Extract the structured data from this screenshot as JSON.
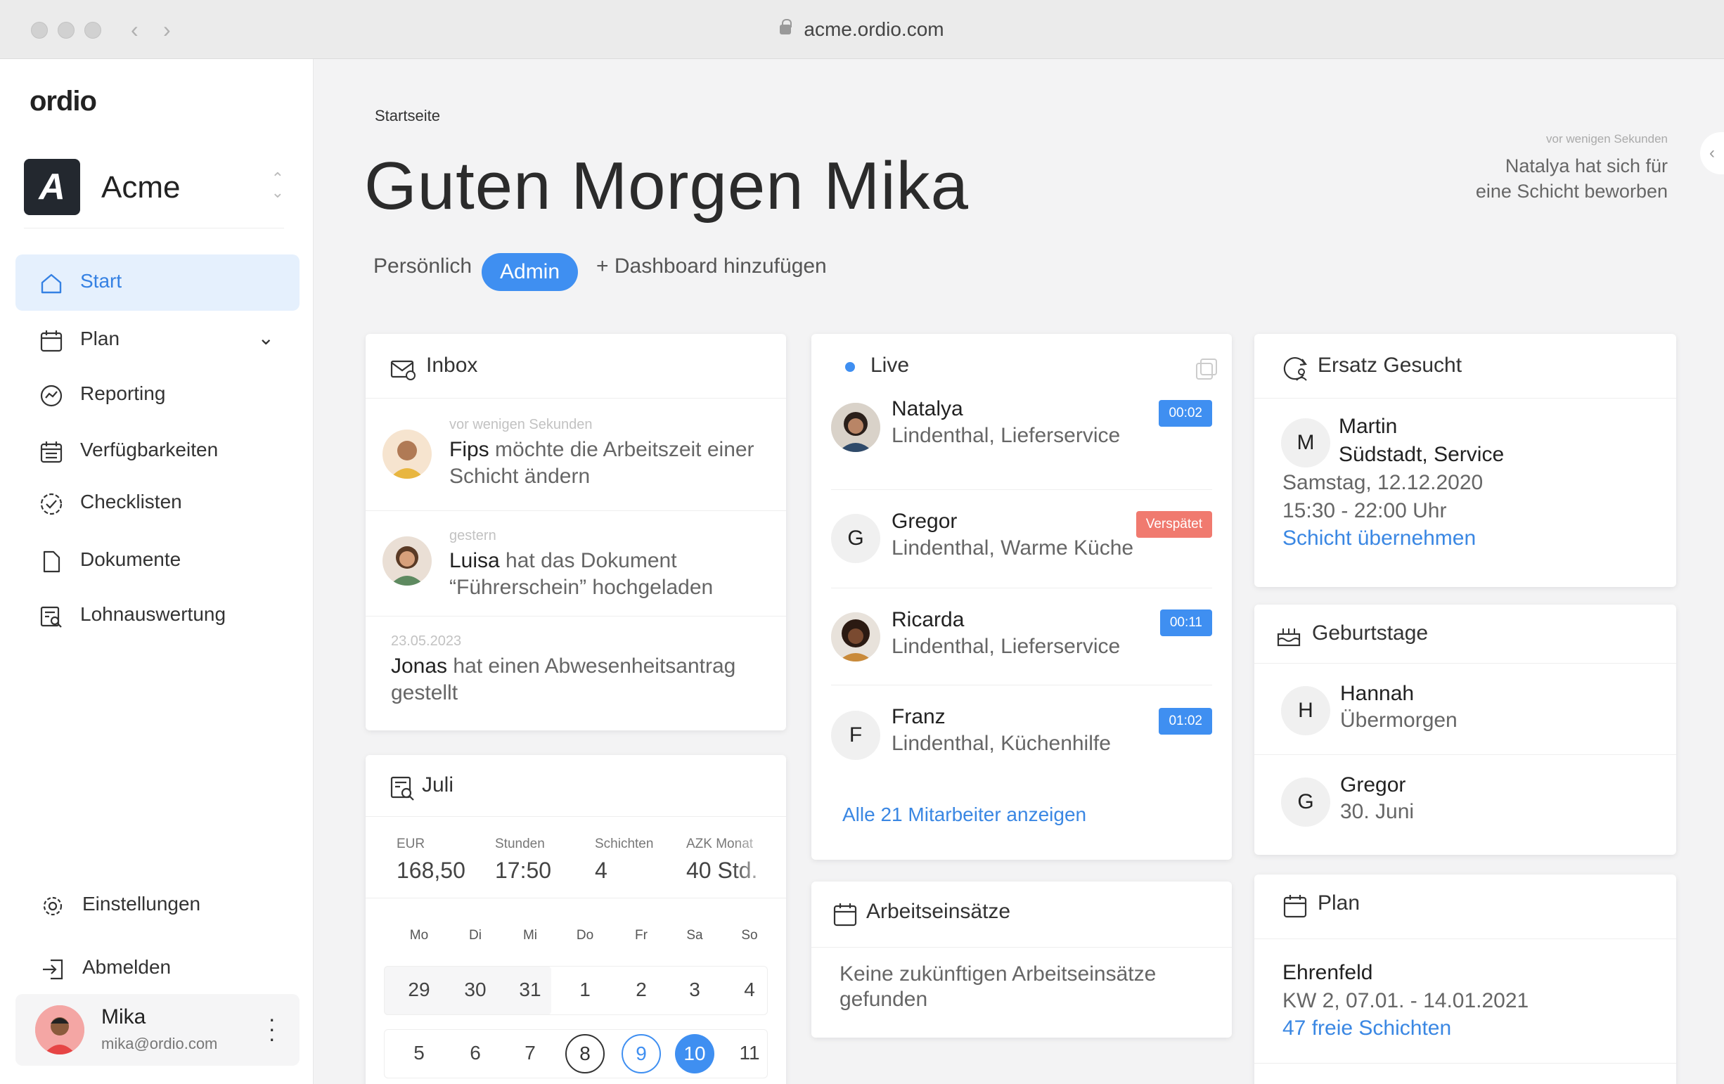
{
  "browser": {
    "url": "acme.ordio.com"
  },
  "sidebar": {
    "logo": "ordio",
    "org": {
      "badge": "A",
      "name": "Acme"
    },
    "nav": [
      {
        "label": "Start"
      },
      {
        "label": "Plan"
      },
      {
        "label": "Reporting"
      },
      {
        "label": "Verfügbarkeiten"
      },
      {
        "label": "Checklisten"
      },
      {
        "label": "Dokumente"
      },
      {
        "label": "Lohnauswertung"
      }
    ],
    "bottom": [
      {
        "label": "Einstellungen"
      },
      {
        "label": "Abmelden"
      }
    ],
    "user": {
      "name": "Mika",
      "email": "mika@ordio.com"
    }
  },
  "header": {
    "breadcrumb": "Startseite",
    "greeting": "Guten Morgen Mika",
    "notification": {
      "time": "vor wenigen Sekunden",
      "line1": "Natalya hat sich für",
      "line2": "eine Schicht beworben"
    },
    "tabs": [
      "Persönlich",
      "Admin",
      "+ Dashboard hinzufügen"
    ]
  },
  "inbox": {
    "title": "Inbox",
    "items": [
      {
        "time": "vor wenigen Sekunden",
        "name": "Fips",
        "line1": " möchte die Arbeitszeit einer",
        "line2": "Schicht ändern"
      },
      {
        "time": "gestern",
        "name": "Luisa",
        "line1": " hat das Dokument",
        "line2": "“Führerschein” hochgeladen"
      },
      {
        "time": "23.05.2023",
        "name": "Jonas",
        "line1": " hat einen Abwesenheitsantrag",
        "line2": "gestellt"
      }
    ]
  },
  "month": {
    "title": "Juli",
    "stats": [
      {
        "label": "EUR",
        "value": "168,50"
      },
      {
        "label": "Stunden",
        "value": "17:50"
      },
      {
        "label": "Schichten",
        "value": "4"
      },
      {
        "label": "AZK Monat",
        "value": "40 Std."
      }
    ],
    "weekdays": [
      "Mo",
      "Di",
      "Mi",
      "Do",
      "Fr",
      "Sa",
      "So"
    ],
    "week1": [
      "29",
      "30",
      "31",
      "1",
      "2",
      "3",
      "4"
    ],
    "week2": [
      "5",
      "6",
      "7",
      "8",
      "9",
      "10",
      "11"
    ]
  },
  "live": {
    "title": "Live",
    "people": [
      {
        "name": "Natalya",
        "detail": "Lindenthal, Lieferservice",
        "tag": "00:02",
        "status": "blue"
      },
      {
        "name": "Gregor",
        "initial": "G",
        "detail": "Lindenthal, Warme Küche",
        "tag": "Verspätet",
        "status": "red"
      },
      {
        "name": "Ricarda",
        "detail": "Lindenthal, Lieferservice",
        "tag": "00:11",
        "status": "blue"
      },
      {
        "name": "Franz",
        "initial": "F",
        "detail": "Lindenthal, Küchenhilfe",
        "tag": "01:02",
        "status": "blue"
      }
    ],
    "link": "Alle 21 Mitarbeiter anzeigen"
  },
  "assignments": {
    "title": "Arbeitseinsätze",
    "empty_line1": "Keine zukünftigen Arbeitseinsätze",
    "empty_line2": "gefunden"
  },
  "replacement": {
    "title": "Ersatz Gesucht",
    "initial": "M",
    "name": "Martin",
    "location": "Südstadt, Service",
    "date": "Samstag, 12.12.2020",
    "time": "15:30 - 22:00 Uhr",
    "action": "Schicht übernehmen"
  },
  "birthdays": {
    "title": "Geburtstage",
    "items": [
      {
        "initial": "H",
        "name": "Hannah",
        "when": "Übermorgen"
      },
      {
        "initial": "G",
        "name": "Gregor",
        "when": "30. Juni"
      }
    ]
  },
  "plan": {
    "title": "Plan",
    "location": "Ehrenfeld",
    "week": "KW 2, 07.01. - 14.01.2021",
    "link": "47 freie Schichten"
  },
  "colors": {
    "accent": "#3f8ff1",
    "late": "#f07a6f",
    "active_bg": "#e5f0fd"
  }
}
